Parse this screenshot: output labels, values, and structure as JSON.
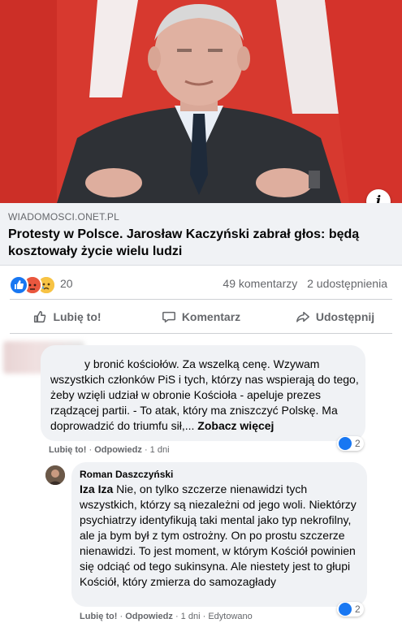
{
  "post": {
    "link": {
      "domain": "WIADOMOSCI.ONET.PL",
      "title": "Protesty w Polsce. Jarosław Kaczyński zabrał głos: będą kosztowały życie wielu ludzi",
      "info_icon": "i"
    },
    "stats": {
      "reaction_icons": [
        "like-icon",
        "angry-icon",
        "sad-icon"
      ],
      "reaction_count": "20",
      "comments": "49 komentarzy",
      "shares": "2 udostępnienia"
    },
    "actions": {
      "like": "Lubię to!",
      "comment": "Komentarz",
      "share": "Udostępnij"
    }
  },
  "comments": [
    {
      "text": "y bronić kościołów. Za wszelką cenę. Wzywam wszystkich członków PiS i tych, którzy nas wspierają do tego, żeby wzięli udział w obronie Kościoła - apeluje prezes rządzącej partii. - To atak, który ma zniszczyć Polskę. Ma doprowadzić do triumfu sił,...",
      "see_more": "Zobacz więcej",
      "like_label": "Lubię to!",
      "reply_label": "Odpowiedz",
      "time": "1 dni",
      "reactions": "2",
      "reply": {
        "author": "Roman Daszczyński",
        "mention": "Iza Iza",
        "text": " Nie, on tylko szczerze nienawidzi tych wszystkich, którzy są niezależni od jego woli. Niektórzy psychiatrzy identyfikują taki mental jako typ nekrofilny, ale ja bym był z tym ostrożny. On po prostu szczerze nienawidzi. To jest moment, w którym Kościół powinien się odciąć od tego sukinsyna. Ale niestety jest to głupi Kościół, który zmierza do samozagłady",
        "like_label": "Lubię to!",
        "reply_label": "Odpowiedz",
        "time": "1 dni",
        "edited": "Edytowano",
        "reactions": "2"
      }
    }
  ],
  "colors": {
    "accent": "#1877f2",
    "secondary_text": "#65676b",
    "bubble": "#f0f2f5"
  }
}
